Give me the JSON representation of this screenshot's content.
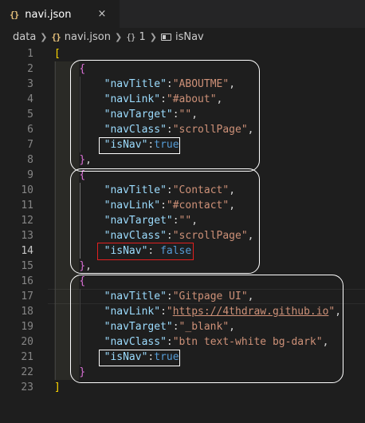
{
  "tab": {
    "icon": "{}",
    "icon_name": "json-file-icon",
    "filename": "navi.json",
    "close": "×"
  },
  "breadcrumb": {
    "segments": [
      "data",
      "navi.json",
      "1",
      "isNav"
    ],
    "json_icon": "{}",
    "object_icon": "{}"
  },
  "editor": {
    "line_numbers": [
      "1",
      "2",
      "3",
      "4",
      "5",
      "6",
      "7",
      "8",
      "9",
      "10",
      "11",
      "12",
      "13",
      "14",
      "15",
      "16",
      "17",
      "18",
      "19",
      "20",
      "21",
      "22",
      "23"
    ],
    "active_line": "14",
    "lines": [
      {
        "tokens": [
          {
            "t": "[",
            "c": "br1"
          }
        ]
      },
      {
        "indent": "    ",
        "tokens": [
          {
            "t": "{",
            "c": "br2"
          }
        ]
      },
      {
        "indent": "        ",
        "tokens": [
          {
            "t": "\"navTitle\"",
            "c": "k"
          },
          {
            "t": ":",
            "c": "p"
          },
          {
            "t": "\"ABOUTME\"",
            "c": "s"
          },
          {
            "t": ",",
            "c": "p"
          }
        ]
      },
      {
        "indent": "        ",
        "tokens": [
          {
            "t": "\"navLink\"",
            "c": "k"
          },
          {
            "t": ":",
            "c": "p"
          },
          {
            "t": "\"#about\"",
            "c": "s"
          },
          {
            "t": ",",
            "c": "p"
          }
        ]
      },
      {
        "indent": "        ",
        "tokens": [
          {
            "t": "\"navTarget\"",
            "c": "k"
          },
          {
            "t": ":",
            "c": "p"
          },
          {
            "t": "\"\"",
            "c": "s"
          },
          {
            "t": ",",
            "c": "p"
          }
        ]
      },
      {
        "indent": "        ",
        "tokens": [
          {
            "t": "\"navClass\"",
            "c": "k"
          },
          {
            "t": ":",
            "c": "p"
          },
          {
            "t": "\"scrollPage\"",
            "c": "s"
          },
          {
            "t": ",",
            "c": "p"
          }
        ]
      },
      {
        "indent": "        ",
        "tokens": [
          {
            "t": "\"isNav\"",
            "c": "k"
          },
          {
            "t": ":",
            "c": "p"
          },
          {
            "t": "true",
            "c": "b"
          }
        ]
      },
      {
        "indent": "    ",
        "tokens": [
          {
            "t": "}",
            "c": "br2"
          },
          {
            "t": ",",
            "c": "p"
          }
        ]
      },
      {
        "indent": "    ",
        "tokens": [
          {
            "t": "{",
            "c": "br2"
          }
        ]
      },
      {
        "indent": "        ",
        "tokens": [
          {
            "t": "\"navTitle\"",
            "c": "k"
          },
          {
            "t": ":",
            "c": "p"
          },
          {
            "t": "\"Contact\"",
            "c": "s"
          },
          {
            "t": ",",
            "c": "p"
          }
        ]
      },
      {
        "indent": "        ",
        "tokens": [
          {
            "t": "\"navLink\"",
            "c": "k"
          },
          {
            "t": ":",
            "c": "p"
          },
          {
            "t": "\"#contact\"",
            "c": "s"
          },
          {
            "t": ",",
            "c": "p"
          }
        ]
      },
      {
        "indent": "        ",
        "tokens": [
          {
            "t": "\"navTarget\"",
            "c": "k"
          },
          {
            "t": ":",
            "c": "p"
          },
          {
            "t": "\"\"",
            "c": "s"
          },
          {
            "t": ",",
            "c": "p"
          }
        ]
      },
      {
        "indent": "        ",
        "tokens": [
          {
            "t": "\"navClass\"",
            "c": "k"
          },
          {
            "t": ":",
            "c": "p"
          },
          {
            "t": "\"scrollPage\"",
            "c": "s"
          },
          {
            "t": ",",
            "c": "p"
          }
        ]
      },
      {
        "indent": "        ",
        "tokens": [
          {
            "t": "\"isNav\"",
            "c": "k"
          },
          {
            "t": ": ",
            "c": "p"
          },
          {
            "t": "false",
            "c": "b"
          }
        ]
      },
      {
        "indent": "    ",
        "tokens": [
          {
            "t": "}",
            "c": "br2"
          },
          {
            "t": ",",
            "c": "p"
          }
        ]
      },
      {
        "indent": "    ",
        "tokens": [
          {
            "t": "{",
            "c": "br2"
          }
        ]
      },
      {
        "indent": "        ",
        "tokens": [
          {
            "t": "\"navTitle\"",
            "c": "k"
          },
          {
            "t": ":",
            "c": "p"
          },
          {
            "t": "\"Gitpage UI\"",
            "c": "s"
          },
          {
            "t": ",",
            "c": "p"
          }
        ]
      },
      {
        "indent": "        ",
        "tokens": [
          {
            "t": "\"navLink\"",
            "c": "k"
          },
          {
            "t": ":",
            "c": "p"
          },
          {
            "t": "\"",
            "c": "s"
          },
          {
            "t": "https://4thdraw.github.io",
            "c": "s link"
          },
          {
            "t": "\"",
            "c": "s"
          },
          {
            "t": ",",
            "c": "p"
          }
        ]
      },
      {
        "indent": "        ",
        "tokens": [
          {
            "t": "\"navTarget\"",
            "c": "k"
          },
          {
            "t": ":",
            "c": "p"
          },
          {
            "t": "\"_blank\"",
            "c": "s"
          },
          {
            "t": ",",
            "c": "p"
          }
        ]
      },
      {
        "indent": "        ",
        "tokens": [
          {
            "t": "\"navClass\"",
            "c": "k"
          },
          {
            "t": ":",
            "c": "p"
          },
          {
            "t": "\"btn text-white bg-dark\"",
            "c": "s"
          },
          {
            "t": ",",
            "c": "p"
          }
        ]
      },
      {
        "indent": "        ",
        "tokens": [
          {
            "t": "\"isNav\"",
            "c": "k"
          },
          {
            "t": ":",
            "c": "p"
          },
          {
            "t": "true",
            "c": "b"
          }
        ]
      },
      {
        "indent": "    ",
        "tokens": [
          {
            "t": "}",
            "c": "br2"
          }
        ]
      },
      {
        "tokens": [
          {
            "t": "]",
            "c": "br1"
          }
        ]
      }
    ]
  },
  "colors": {
    "background": "#1e1e1e",
    "key": "#9cdcfe",
    "string": "#ce9178",
    "boolean": "#569cd6",
    "bracket_outer": "#ffd700",
    "bracket_inner": "#da70d6",
    "highlight_red": "#e02020",
    "highlight_white": "#ffffff"
  }
}
